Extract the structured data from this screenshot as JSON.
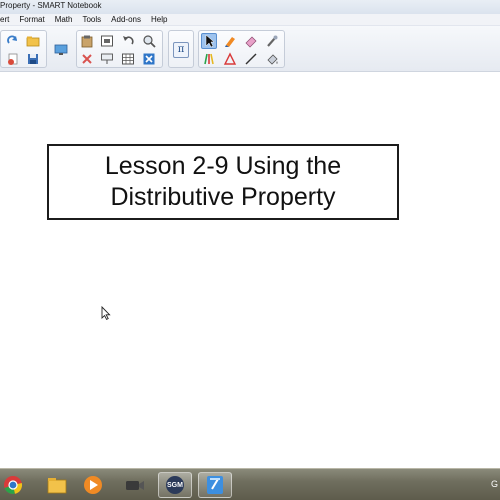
{
  "window": {
    "title": "Property - SMART Notebook"
  },
  "menu": [
    "ert",
    "Format",
    "Math",
    "Tools",
    "Add-ons",
    "Help"
  ],
  "toolbar": {
    "buttons": [
      {
        "icon": "redo-icon"
      },
      {
        "icon": "open-folder-icon"
      },
      {
        "icon": "delete-page-icon"
      },
      {
        "icon": "save-icon"
      },
      {
        "icon": "display-screen-icon"
      },
      {
        "icon": "paste-icon"
      },
      {
        "icon": "screen-capture-icon"
      },
      {
        "icon": "undo-icon"
      },
      {
        "icon": "zoom-icon"
      },
      {
        "icon": "delete-icon"
      },
      {
        "icon": "screen-shade-icon"
      },
      {
        "icon": "table-icon"
      },
      {
        "icon": "close-icon"
      },
      {
        "icon": "math-equation-icon"
      },
      {
        "icon": "select-arrow-icon"
      },
      {
        "icon": "pen-icon"
      },
      {
        "icon": "eraser-icon"
      },
      {
        "icon": "magic-pen-icon"
      },
      {
        "icon": "creative-pens-icon"
      },
      {
        "icon": "shapes-icon"
      },
      {
        "icon": "line-icon"
      },
      {
        "icon": "fill-icon"
      }
    ],
    "selected": "select-arrow-icon",
    "math_symbol": "π"
  },
  "canvas": {
    "title_lines": [
      "Lesson 2-9 Using the",
      "Distributive Property"
    ]
  },
  "taskbar": {
    "items": [
      "chrome-icon",
      "file-explorer-icon",
      "media-player-icon",
      "video-camera-icon",
      "sgm-icon",
      "smart-notebook-icon"
    ],
    "sgm_label": "SGM",
    "tray_text": "G"
  },
  "colors": {
    "accent": "#9ec3ee",
    "border": "#1c1c1c",
    "taskbar": "#6f6e5e"
  }
}
